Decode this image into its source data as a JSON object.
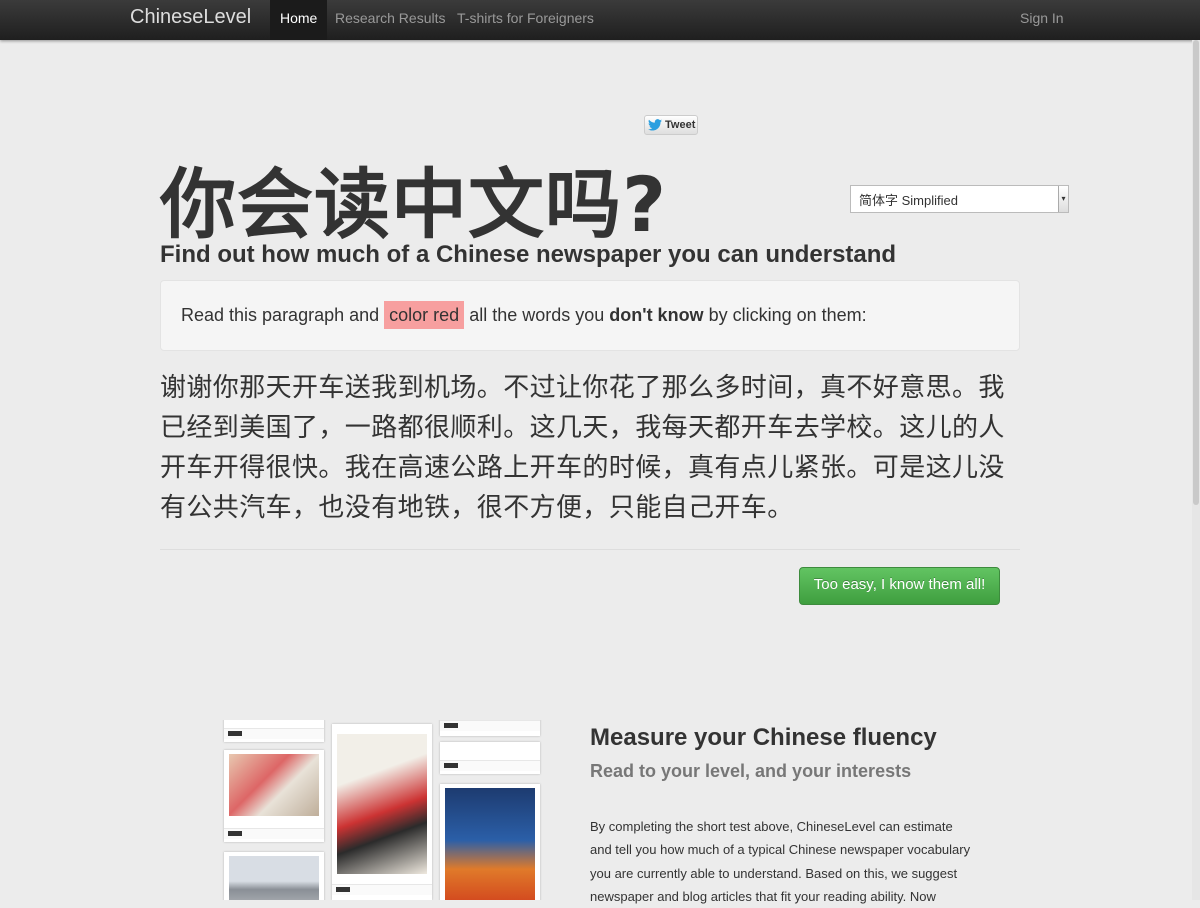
{
  "nav": {
    "brand": "ChineseLevel",
    "items": [
      "Home",
      "Research Results",
      "T-shirts for Foreigners"
    ],
    "sign_in": "Sign In"
  },
  "tweet_label": "Tweet",
  "heading": "你会读中文吗?",
  "subheading": "Find out how much of a Chinese newspaper you can understand",
  "script_select": {
    "selected": "简体字 Simplified"
  },
  "instructions": {
    "before": "Read this paragraph and",
    "highlight": "color red",
    "middle": "all the words you",
    "bold": "don't know",
    "after": "by clicking on them:"
  },
  "paragraph": "谢谢你那天开车送我到机场。不过让你花了那么多时间，真不好意思。我已经到美国了，一路都很顺利。这几天，我每天都开车去学校。这儿的人开车开得很快。我在高速公路上开车的时候，真有点儿紧张。可是这儿没有公共汽车，也没有地铁，很不方便，只能自己开车。",
  "easy_button": "Too easy, I know them all!",
  "feature": {
    "title": "Measure your Chinese fluency",
    "subtitle": "Read to your level, and your interests",
    "body": "By completing the short test above, ChineseLevel can estimate and tell you how much of a typical Chinese newspaper vocabulary you are currently able to understand. Based on this, we suggest newspaper and blog articles that fit your reading ability. Now"
  },
  "colors": {
    "navbar": "#222222",
    "highlight_red": "#f79f9f",
    "button_green": "#51a351"
  }
}
